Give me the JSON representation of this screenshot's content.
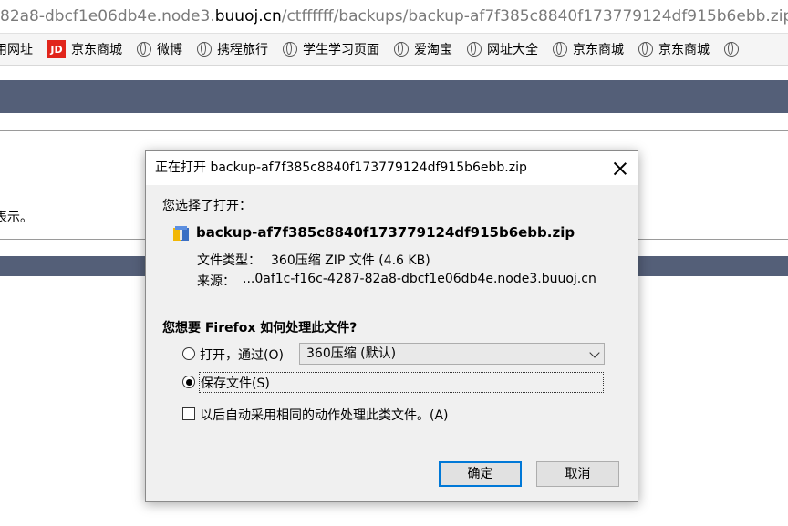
{
  "browser": {
    "url": {
      "prefix": "82a8-dbcf1e06db4e.node3.",
      "host": "buuoj.cn",
      "path": "/ctffffff/backups/backup-af7f385c8840f173779124df915b6ebb.zip"
    },
    "bookmarks": [
      {
        "label": "用网址",
        "icon": "none"
      },
      {
        "label": "京东商城",
        "icon": "jd-logo"
      },
      {
        "label": "微博",
        "icon": "globe-icon"
      },
      {
        "label": "携程旅行",
        "icon": "globe-icon"
      },
      {
        "label": "学生学习页面",
        "icon": "globe-icon"
      },
      {
        "label": "爱淘宝",
        "icon": "globe-icon"
      },
      {
        "label": "网址大全",
        "icon": "globe-icon"
      },
      {
        "label": "京东商城",
        "icon": "globe-icon"
      },
      {
        "label": "京东商城",
        "icon": "globe-icon"
      }
    ],
    "jd_logo_text": "JD"
  },
  "page": {
    "fragment_text": "表示。",
    "band_color": "#545f78"
  },
  "dialog": {
    "title": "正在打开 backup-af7f385c8840f173779124df915b6ebb.zip",
    "chosen_label": "您选择了打开：",
    "file_name": "backup-af7f385c8840f173779124df915b6ebb.zip",
    "file_type_label": "文件类型：",
    "file_type_value": "360压缩 ZIP 文件 (4.6 KB)",
    "source_label": "来源：",
    "source_value": "...0af1c-f16c-4287-82a8-dbcf1e06db4e.node3.buuoj.cn",
    "question": "您想要 Firefox 如何处理此文件?",
    "open_with_label": "打开，通过(O)",
    "open_with_app": "360压缩 (默认)",
    "save_file_label": "保存文件(S)",
    "auto_label": "以后自动采用相同的动作处理此类文件。(A)",
    "ok_label": "确定",
    "cancel_label": "取消",
    "selected_option": "save_file",
    "accent_color": "#0078d7"
  }
}
